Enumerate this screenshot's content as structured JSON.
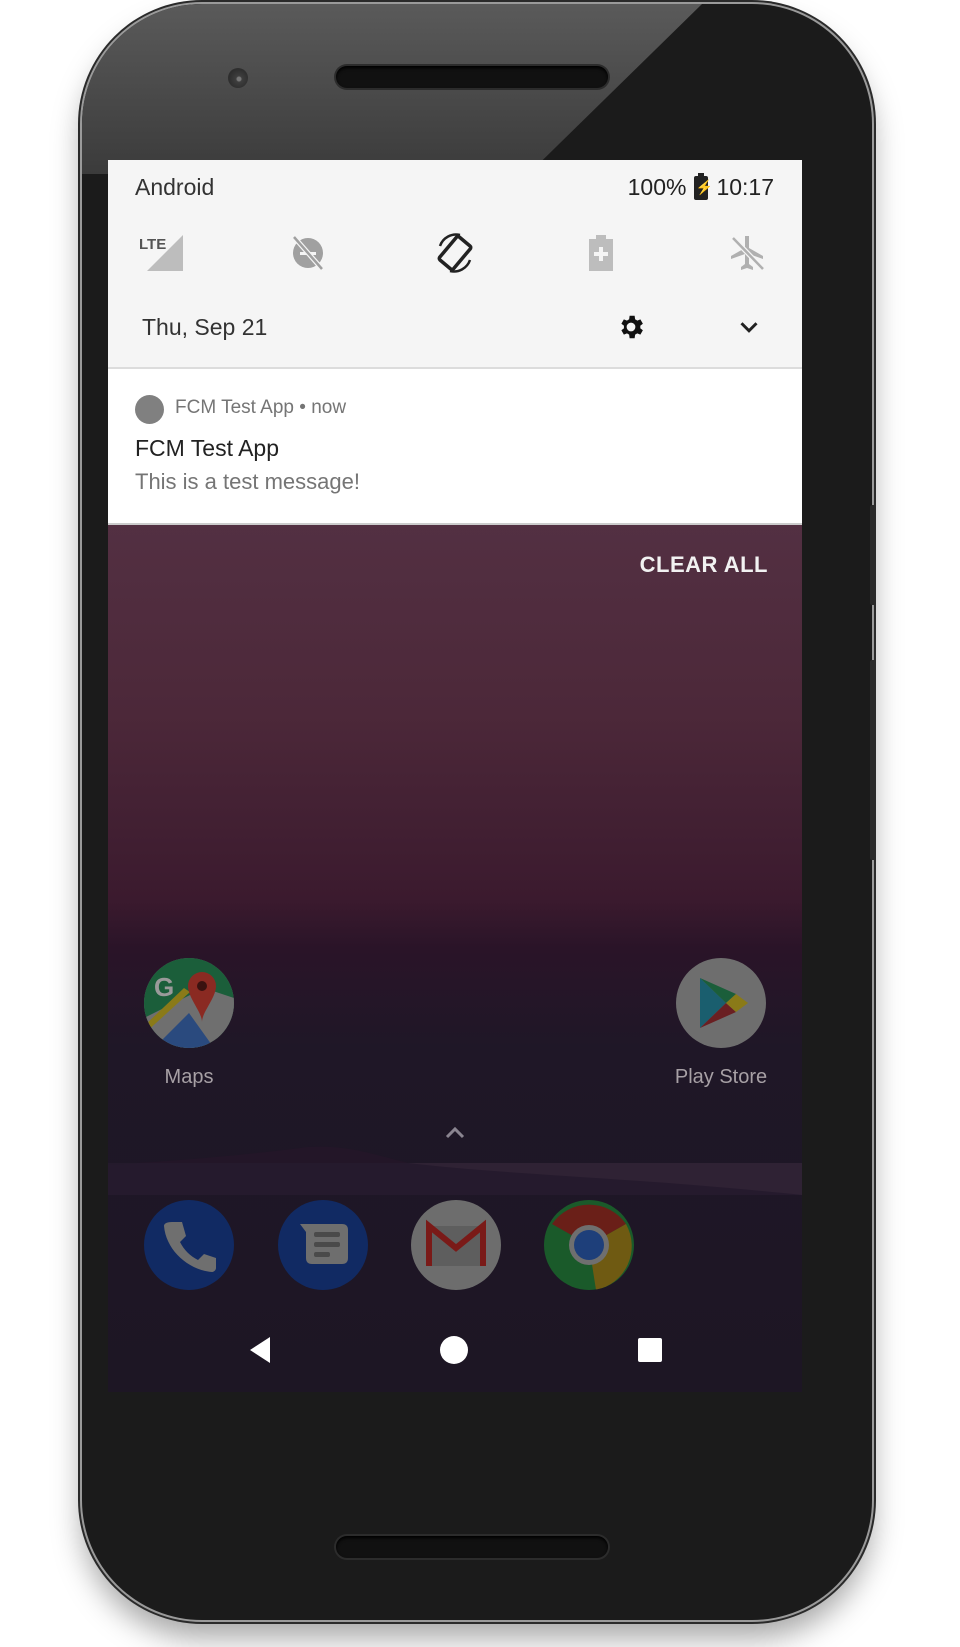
{
  "status_bar": {
    "carrier": "Android",
    "battery": "100%",
    "battery_icon": "battery-charging-icon",
    "time": "10:17"
  },
  "quick_settings": {
    "tiles": [
      {
        "name": "mobile-data",
        "icon": "lte-signal-icon",
        "label": "LTE",
        "active": false
      },
      {
        "name": "data-saver",
        "icon": "data-saver-off-icon",
        "active": false
      },
      {
        "name": "auto-rotate",
        "icon": "screen-rotation-icon",
        "active": true
      },
      {
        "name": "battery-saver",
        "icon": "battery-saver-icon",
        "active": false
      },
      {
        "name": "airplane-mode",
        "icon": "airplane-off-icon",
        "active": false
      }
    ],
    "date": "Thu, Sep 21",
    "settings_icon": "gear-icon",
    "expand_icon": "chevron-down-icon"
  },
  "notification": {
    "app_name": "FCM Test App",
    "separator": "•",
    "time": "now",
    "header": "FCM Test App • now",
    "title": "FCM Test App",
    "text": "This is a test message!"
  },
  "clear_all_label": "CLEAR ALL",
  "home": {
    "apps": [
      {
        "label": "Maps",
        "icon": "maps-icon"
      },
      {
        "label": "Play Store",
        "icon": "play-store-icon"
      }
    ],
    "dock": [
      {
        "name": "Phone",
        "icon": "phone-icon"
      },
      {
        "name": "Messages",
        "icon": "messages-icon"
      },
      {
        "name": "Gmail",
        "icon": "gmail-icon"
      },
      {
        "name": "Chrome",
        "icon": "chrome-icon"
      }
    ]
  },
  "navigation": {
    "back": "back-icon",
    "home": "home-icon",
    "recents": "recents-icon"
  },
  "colors": {
    "shade_bg": "#f5f5f5",
    "wallpaper_top": "#5e3d4c",
    "wallpaper_bottom": "#1d1624"
  }
}
